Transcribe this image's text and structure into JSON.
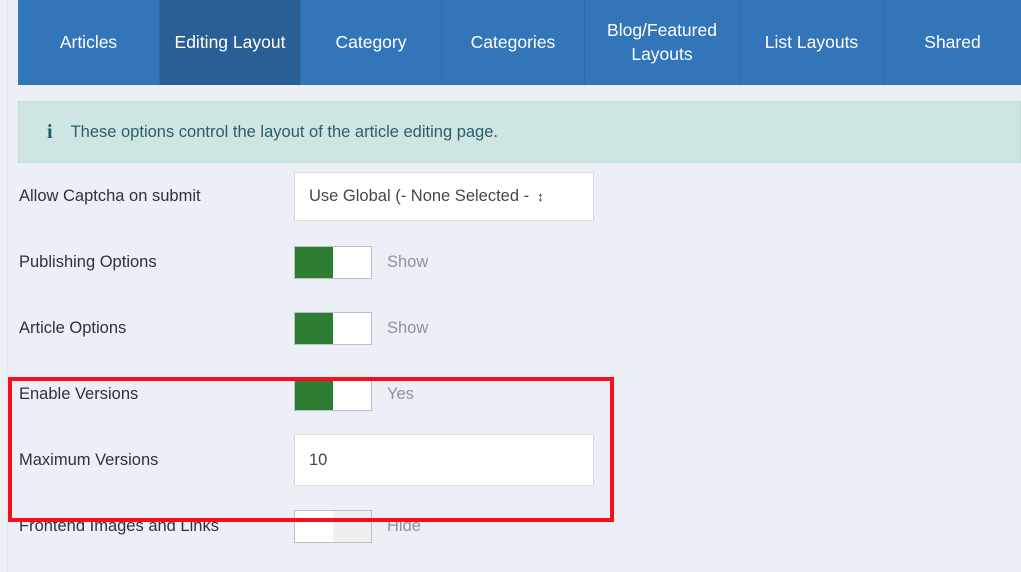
{
  "tabs": [
    {
      "label": "Articles",
      "active": false
    },
    {
      "label": "Editing\nLayout",
      "active": true
    },
    {
      "label": "Category",
      "active": false
    },
    {
      "label": "Categories",
      "active": false
    },
    {
      "label": "Blog/Featured\nLayouts",
      "active": false
    },
    {
      "label": "List Layouts",
      "active": false
    },
    {
      "label": "Shared",
      "active": false
    }
  ],
  "tab_labels": {
    "articles": "Articles",
    "editing_layout": "Editing Layout",
    "category": "Category",
    "categories": "Categories",
    "blog_featured_layouts": "Blog/Featured Layouts",
    "list_layouts": "List Layouts",
    "shared": "Shared"
  },
  "info_banner": {
    "icon": "info-icon",
    "icon_glyph": "i",
    "text": "These options control the layout of the article editing page."
  },
  "form": {
    "rows": [
      {
        "label": "Allow Captcha on submit",
        "type": "select",
        "value": "Use Global (- None Selected -",
        "arrow_glyph": "↕"
      },
      {
        "label": "Publishing Options",
        "type": "toggle",
        "state": "on",
        "state_label": "Show"
      },
      {
        "label": "Article Options",
        "type": "toggle",
        "state": "on",
        "state_label": "Show"
      },
      {
        "label": "Enable Versions",
        "type": "toggle",
        "state": "on",
        "state_label": "Yes"
      },
      {
        "label": "Maximum Versions",
        "type": "input",
        "value": "10",
        "placeholder": ""
      },
      {
        "label": "Frontend Images and Links",
        "type": "toggle",
        "state": "off",
        "state_label": "Hide"
      }
    ]
  },
  "colors": {
    "tab_inactive": "#3275b8",
    "tab_active": "#2a5f96",
    "page_background": "#eceff5",
    "info_banner_background": "#cee5e4",
    "info_banner_text": "#28606a",
    "toggle_on": "#2d7d32",
    "toggle_off_track": "#efefef",
    "highlight_border": "#fc0d1b",
    "label_text": "#2e3338",
    "state_text": "#8d949c"
  }
}
